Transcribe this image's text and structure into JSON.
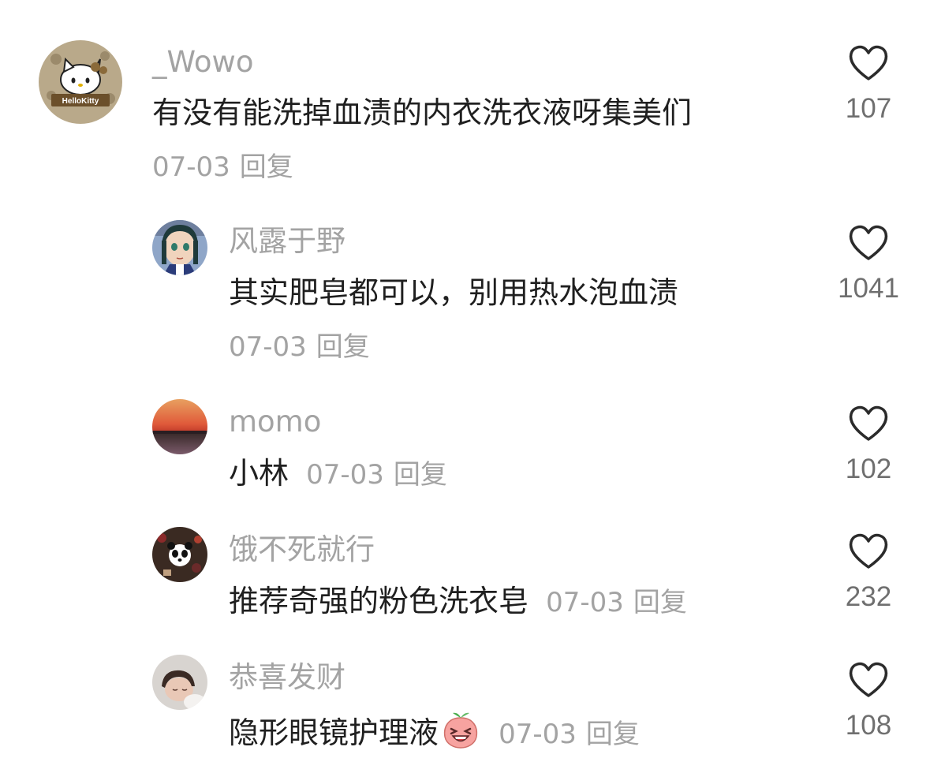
{
  "comments": [
    {
      "username": "_Wowo",
      "text": "有没有能洗掉血渍的内衣洗衣液呀集美们",
      "date": "07-03",
      "reply": "回复",
      "likes": "107",
      "avatar_label": "HelloKitty"
    },
    {
      "username": "风露于野",
      "text": "其实肥皂都可以，别用热水泡血渍",
      "date": "07-03",
      "reply": "回复",
      "likes": "1041"
    },
    {
      "username": "momo",
      "text": "小林",
      "date": "07-03",
      "reply": "回复",
      "likes": "102"
    },
    {
      "username": "饿不死就行",
      "text": "推荐奇强的粉色洗衣皂",
      "date": "07-03",
      "reply": "回复",
      "likes": "232"
    },
    {
      "username": "恭喜发财",
      "text": "隐形眼镜护理液",
      "date": "07-03",
      "reply": "回复",
      "likes": "108"
    }
  ],
  "colors": {
    "username": "#a3a3a3",
    "text": "#1f1f1f",
    "meta": "#a3a3a3",
    "count": "#6f6f6f",
    "heart_stroke": "#2b2b2b"
  },
  "icons": {
    "like": "heart-outline-icon",
    "emoji": "laughing-peach-emoji-icon"
  }
}
